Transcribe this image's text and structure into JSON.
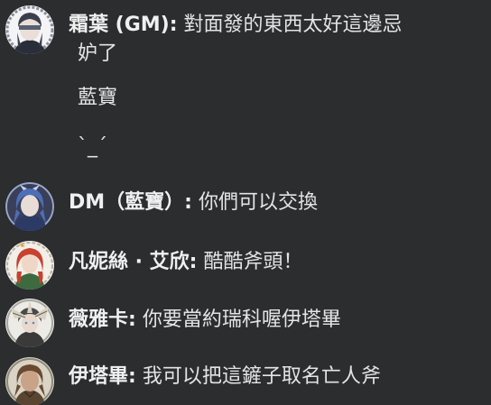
{
  "messages": [
    {
      "author": "霜葉 (GM):",
      "text": "對面發的東西太好這邊忌",
      "text_wrap": "妒了",
      "followups": [
        "藍寶",
        "`_´"
      ],
      "avatar_icon": "masked-character-avatar"
    },
    {
      "author": "DM（藍寶）:",
      "text": "你們可以交換",
      "avatar_icon": "blue-haired-character-avatar"
    },
    {
      "author": "凡妮絲 · 艾欣:",
      "text": "酷酷斧頭！",
      "avatar_icon": "red-haired-character-avatar"
    },
    {
      "author": "薇雅卡:",
      "text": "你要當約瑞科喔伊塔畢",
      "avatar_icon": "feathered-character-avatar"
    },
    {
      "author": "伊塔畢:",
      "text": "我可以把這鏟子取名亡人斧",
      "avatar_icon": "brown-haired-character-avatar"
    }
  ],
  "colors": {
    "background": "#2b2d2f",
    "name": "#f0f0f0",
    "text": "#e4e4e4"
  }
}
